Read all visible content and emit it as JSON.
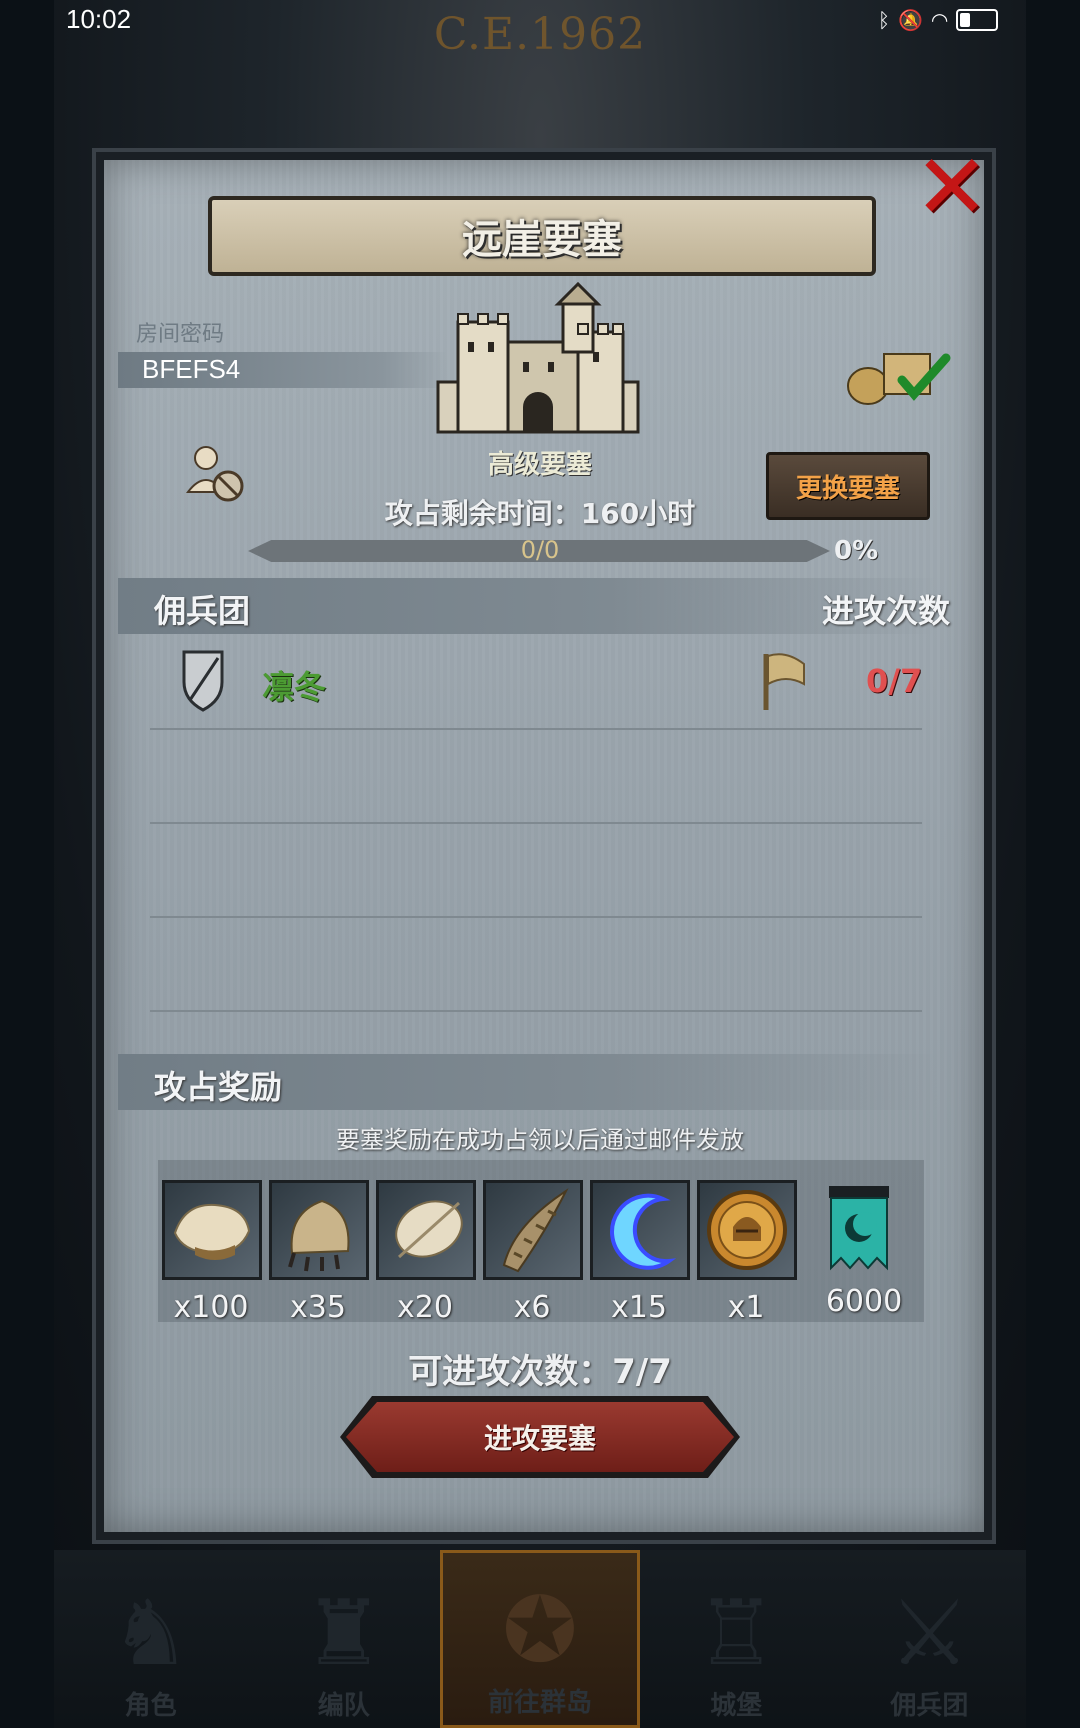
{
  "status_bar": {
    "time": "10:02",
    "icons": [
      "bluetooth-icon",
      "mute-icon",
      "wifi-icon",
      "battery-icon"
    ]
  },
  "background": {
    "date_text": "C.E.1962"
  },
  "dialog": {
    "title": "远崖要塞",
    "room": {
      "label": "房间密码",
      "code": "BFEFS4"
    },
    "fortress_level": "高级要塞",
    "change_button": "更换要塞",
    "time_left": "攻占剩余时间：160小时",
    "progress": {
      "text": "0/0",
      "percent_text": "0%",
      "fraction": 0
    },
    "mercenary_section": {
      "left_label": "佣兵团",
      "right_label": "进攻次数"
    },
    "mercenaries": [
      {
        "name": "凛冬",
        "attacks": "0/7"
      }
    ],
    "reward_section": {
      "label": "攻占奖励",
      "note": "要塞奖励在成功占领以后通过邮件发放"
    },
    "rewards": [
      {
        "icon": "fur-pelt-icon",
        "qty": "x100"
      },
      {
        "icon": "beast-claw-icon",
        "qty": "x35"
      },
      {
        "icon": "feather-fur-icon",
        "qty": "x20"
      },
      {
        "icon": "horn-icon",
        "qty": "x6"
      },
      {
        "icon": "crescent-energy-icon",
        "qty": "x15"
      },
      {
        "icon": "helmet-medal-icon",
        "qty": "x1"
      },
      {
        "icon": "guild-banner-icon",
        "qty": "6000"
      }
    ],
    "attacks_available": "可进攻次数：7/7",
    "attack_button": "进攻要塞"
  },
  "bottom_nav": [
    {
      "label": "角色",
      "active": false
    },
    {
      "label": "编队",
      "active": false
    },
    {
      "label": "前往群岛",
      "active": true
    },
    {
      "label": "城堡",
      "active": false
    },
    {
      "label": "佣兵团",
      "active": false
    }
  ],
  "colors": {
    "accent_orange": "#f3a248",
    "green_name": "#4c9b33",
    "red_count": "#e05050",
    "close_red": "#c41616"
  }
}
